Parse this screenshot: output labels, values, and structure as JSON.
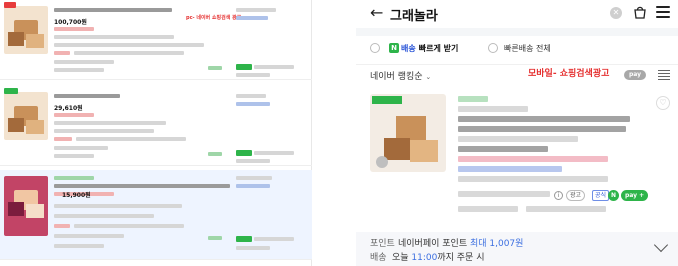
{
  "pc": {
    "ad_note": "pc- 네이버 쇼핑검색 광고",
    "items": [
      {
        "badge": "",
        "badge_color": "red",
        "price": "100,700원",
        "highlight": false
      },
      {
        "badge": "",
        "badge_color": "green",
        "price": "29,610원",
        "highlight": false
      },
      {
        "badge": "",
        "badge_color": "green",
        "price": "15,900원",
        "highlight": true
      }
    ]
  },
  "mobile": {
    "header": {
      "back_icon": "arrow-left-icon",
      "query": "그래놀라",
      "clear_icon": "clear-icon",
      "bag_icon": "shopping-bag-icon",
      "menu_icon": "menu-icon"
    },
    "filters": {
      "delivery_icon_label": "N",
      "delivery_label": "배송",
      "delivery_sub": "빠르게 받기",
      "fast_delivery_all": "빠른배송 전체"
    },
    "sort": {
      "label": "네이버 랭킹순",
      "ad_note": "모바일- 쇼핑검색광고",
      "npay": "pay"
    },
    "card": {
      "ad_label": "광고",
      "official_label": "공식",
      "npay_label": "N",
      "npay_plus_label": "pay +"
    },
    "footer": {
      "point_label": "포인트",
      "point_prefix": "네이버페이 포인트 ",
      "point_value": "최대 1,007원",
      "delivery_label": "배송",
      "delivery_prefix": "오늘 ",
      "delivery_time": "11:00",
      "delivery_suffix": "까지 주문 시"
    }
  },
  "colors": {
    "naver_green": "#2eb44a",
    "link_blue": "#3c6fe0",
    "ad_red": "#e53030"
  }
}
